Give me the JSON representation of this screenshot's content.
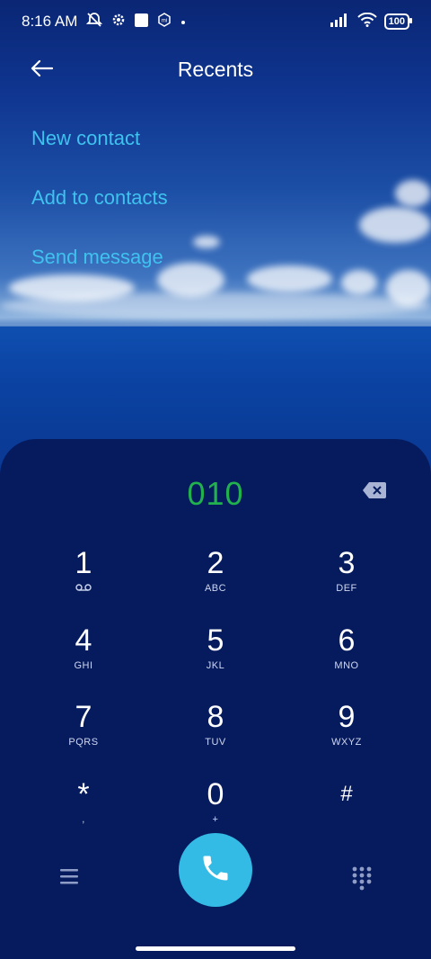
{
  "status_bar": {
    "time": "8:16 AM",
    "battery": "100",
    "icons": [
      "muted-alarm-icon",
      "settings-gear-icon",
      "square-notification-icon",
      "mi-icon",
      "dot-icon",
      "signal-icon",
      "wifi-icon",
      "battery-icon"
    ]
  },
  "header": {
    "title": "Recents",
    "back_icon": "arrow-left-icon"
  },
  "options": {
    "new_contact": "New contact",
    "add_to_contacts": "Add to contacts",
    "send_message": "Send message"
  },
  "dialer": {
    "number": "010",
    "backspace_icon": "backspace-icon",
    "keys": [
      {
        "digit": "1",
        "letters": ""
      },
      {
        "digit": "2",
        "letters": "ABC"
      },
      {
        "digit": "3",
        "letters": "DEF"
      },
      {
        "digit": "4",
        "letters": "GHI"
      },
      {
        "digit": "5",
        "letters": "JKL"
      },
      {
        "digit": "6",
        "letters": "MNO"
      },
      {
        "digit": "7",
        "letters": "PQRS"
      },
      {
        "digit": "8",
        "letters": "TUV"
      },
      {
        "digit": "9",
        "letters": "WXYZ"
      },
      {
        "digit": "*",
        "letters": ","
      },
      {
        "digit": "0",
        "letters": "+"
      },
      {
        "digit": "#",
        "letters": ""
      }
    ],
    "menu_icon": "menu-icon",
    "call_icon": "phone-icon",
    "keypad_icon": "dialpad-icon"
  },
  "colors": {
    "accent": "#3fc2ee",
    "number": "#21b24e",
    "call_button": "#33bbe6",
    "sheet": "#061b5e"
  }
}
